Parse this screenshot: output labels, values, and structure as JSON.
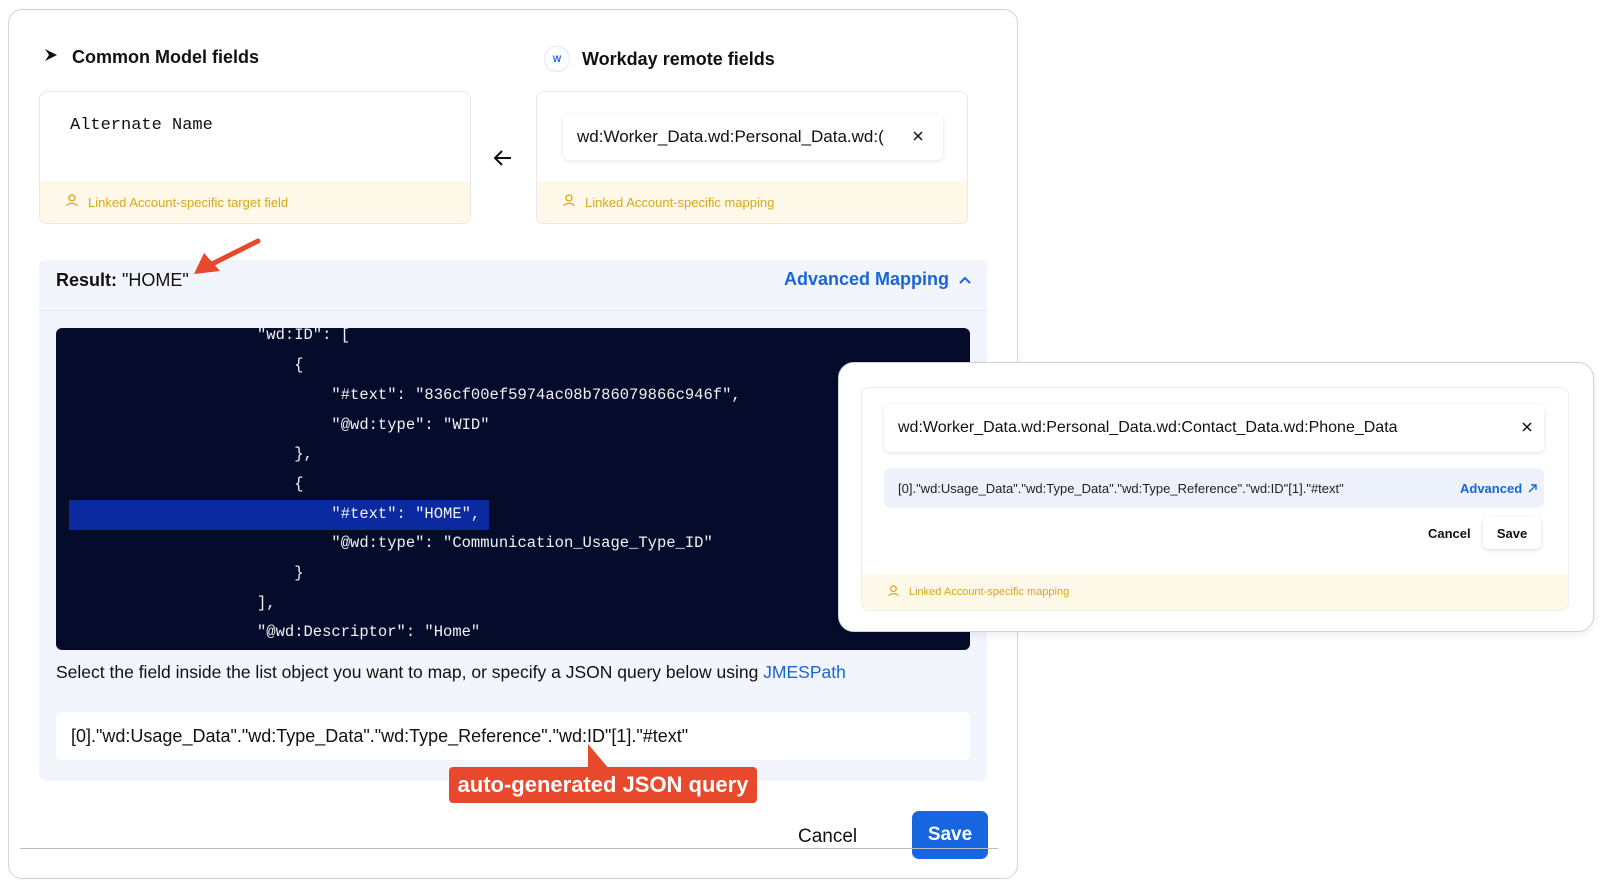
{
  "common_model": {
    "title": "Common Model fields",
    "field_value": "Alternate Name",
    "footer": "Linked Account-specific target field"
  },
  "remote": {
    "title": "Workday remote fields",
    "logo_letter": "W",
    "field_value": "wd:Worker_Data.wd:Personal_Data.wd:(",
    "footer": "Linked Account-specific mapping"
  },
  "result": {
    "label": "Result:",
    "value": "\"HOME\"",
    "advanced_toggle": "Advanced Mapping"
  },
  "code_lines": [
    "\"wd:ID\": [",
    "    {",
    "        \"#text\": \"836cf00ef5974ac08b786079866c946f\",",
    "        \"@wd:type\": \"WID\"",
    "    },",
    "    {",
    "        \"#text\": \"HOME\",",
    "        \"@wd:type\": \"Communication_Usage_Type_ID\"",
    "    }",
    "],",
    "\"@wd:Descriptor\": \"Home\""
  ],
  "instructions": {
    "text": "Select the field inside the list object you want to map, or specify a JSON query below using ",
    "link": "JMESPath"
  },
  "query": {
    "value": "[0].\"wd:Usage_Data\".\"wd:Type_Data\".\"wd:Type_Reference\".\"wd:ID\"[1].\"#text\""
  },
  "annotation": "auto-generated JSON query",
  "actions": {
    "cancel": "Cancel",
    "save": "Save"
  },
  "popup": {
    "field_value": "wd:Worker_Data.wd:Personal_Data.wd:Contact_Data.wd:Phone_Data",
    "query": "[0].\"wd:Usage_Data\".\"wd:Type_Data\".\"wd:Type_Reference\".\"wd:ID\"[1].\"#text\"",
    "advanced_link": "Advanced",
    "cancel": "Cancel",
    "save": "Save",
    "footer": "Linked Account-specific mapping"
  },
  "colors": {
    "primary": "#1765e0",
    "annotation": "#e8482c",
    "code_bg": "#050c2b",
    "footer_text": "#d6a81b"
  }
}
